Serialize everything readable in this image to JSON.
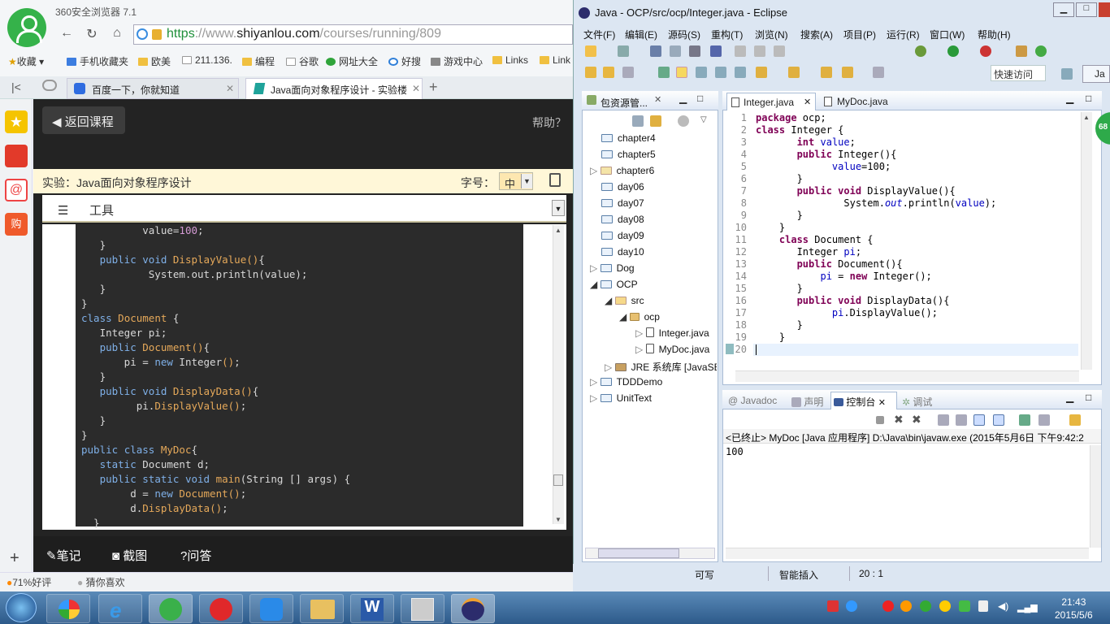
{
  "browser": {
    "title": "360安全浏览器 7.1",
    "url_scheme": "https",
    "url_sep": "://www.",
    "url_domain": "shiyanlou.com",
    "url_path": "/courses/running/809",
    "bookmarks": [
      "收藏",
      "手机收藏夹",
      "欧美",
      "211.136.",
      "编程",
      "谷歌",
      "网址大全",
      "好搜",
      "游戏中心",
      "Links",
      "Link"
    ],
    "tabs": [
      {
        "label": "百度一下，你就知道"
      },
      {
        "label": "Java面向对象程序设计 - 实验楼"
      }
    ],
    "status_rating": "71%好评",
    "status_guess": "猜你喜欢"
  },
  "page": {
    "back_button": "返回课程",
    "help": "帮助？",
    "lab_title": "实验：Java面向对象程序设计",
    "font_label": "字号：",
    "font_value": "中",
    "tools_label": "工具",
    "bottom_actions": [
      "笔记",
      "截图",
      "问答"
    ]
  },
  "web_code": [
    "          value=100;",
    "   }",
    "   public void DisplayValue(){",
    "           System.out.println(value);",
    "   }",
    "}",
    "class Document {",
    "   Integer pi;",
    "   public Document(){",
    "       pi = new Integer();",
    "   }",
    "   public void DisplayData(){",
    "         pi.DisplayValue();",
    "   }",
    "}",
    "public class MyDoc{",
    "   static Document d;",
    "   public static void main(String [] args) {",
    "        d = new Document();",
    "        d.DisplayData();",
    "  }"
  ],
  "eclipse": {
    "title": "Java - OCP/src/ocp/Integer.java - Eclipse",
    "menu": [
      "文件(F)",
      "编辑(E)",
      "源码(S)",
      "重构(T)",
      "浏览(N)",
      "搜索(A)",
      "项目(P)",
      "运行(R)",
      "窗口(W)",
      "帮助(H)"
    ],
    "quick_access": "快速访问",
    "package_explorer_title": "包资源管...",
    "tree": [
      "chapter4",
      "chapter5",
      "chapter6",
      "day06",
      "day07",
      "day08",
      "day09",
      "day10",
      "Dog",
      "OCP",
      "src",
      "ocp",
      "Integer.java",
      "MyDoc.java",
      "JRE 系统库 [JavaSE",
      "TDDDemo",
      "UnitText"
    ],
    "editor_tabs": [
      "Integer.java",
      "MyDoc.java"
    ],
    "line_numbers": "1\n2\n3\n4\n5\n6\n7\n8\n9\n10\n11\n12\n13\n14\n15\n16\n17\n18\n19\n20",
    "code": [
      "package ocp;",
      "class Integer {",
      "       int value;",
      "       public Integer(){",
      "             value=100;",
      "       }",
      "       public void DisplayValue(){",
      "               System.out.println(value);",
      "       }",
      "    }",
      "    class Document {",
      "       Integer pi;",
      "       public Document(){",
      "           pi = new Integer();",
      "       }",
      "       public void DisplayData(){",
      "             pi.DisplayValue();",
      "       }",
      "    }",
      ""
    ],
    "console_tabs": [
      "Javadoc",
      "声明",
      "控制台",
      "调试"
    ],
    "console_header": "<已终止> MyDoc [Java 应用程序] D:\\Java\\bin\\javaw.exe (2015年5月6日 下午9:42:2",
    "console_output": "100",
    "status": {
      "writable": "可写",
      "insert": "智能插入",
      "position": "20 : 1"
    },
    "badge": "68"
  },
  "taskbar": {
    "time": "21:43",
    "date": "2015/5/6"
  },
  "colors": {
    "browser_green": "#35b24a",
    "page_bg": "#232323",
    "keyword": "#7f0055",
    "field": "#0000c0"
  }
}
